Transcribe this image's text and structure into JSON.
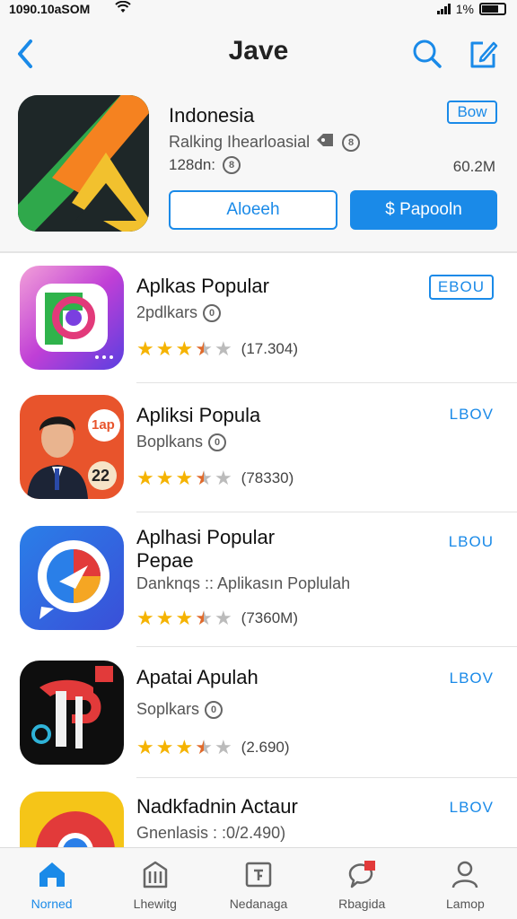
{
  "status_bar": {
    "time": "1090.10aSOM",
    "battery_text": "1%"
  },
  "nav": {
    "title": "Jave"
  },
  "featured": {
    "name": "Indonesia",
    "badge": "Bow",
    "subtitle": "Ralking Ihearloasial",
    "sub_badge": "8",
    "size_left": "128dn:",
    "size_badge": "8",
    "size_right": "60.2M",
    "button_outline": "Aloeeh",
    "button_solid": "Papooln",
    "button_solid_icon": "$"
  },
  "apps": [
    {
      "name": "Aplkas Popular",
      "sub": "2pdlkars",
      "sub_badge": "0",
      "stars": 3.5,
      "count": "(17.304)",
      "get": "EBOU",
      "boxed": true
    },
    {
      "name": "Apliksi Popula",
      "sub": "Boplkans",
      "sub_badge": "0",
      "stars": 3.5,
      "count": "(78330)",
      "get": "LBOV",
      "boxed": false,
      "badge_text": "1ap",
      "badge_num": "22"
    },
    {
      "name": "Aplhasi Popular\nPepae",
      "sub": "Danknqs :: Aplikasın Poplulah",
      "stars": 3.5,
      "count": "(7360M)",
      "get": "LBOU",
      "boxed": false
    },
    {
      "name": "Apatai Apulah",
      "sub": "Soplkars",
      "sub_badge": "0",
      "stars": 3.5,
      "count": "(2.690)",
      "get": "LBOV",
      "boxed": false
    },
    {
      "name": "Nadkfadnin Actaur",
      "sub": "Gnenlasis : :0/2.490)",
      "get": "LBOV",
      "boxed": false
    }
  ],
  "tabs": [
    {
      "label": "Norned",
      "active": true
    },
    {
      "label": "Lhewitg",
      "active": false
    },
    {
      "label": "Nedanaga",
      "active": false
    },
    {
      "label": "Rbagida",
      "active": false
    },
    {
      "label": "Lamop",
      "active": false
    }
  ],
  "colors": {
    "accent": "#1a8ae8",
    "star": "#f5b301"
  }
}
